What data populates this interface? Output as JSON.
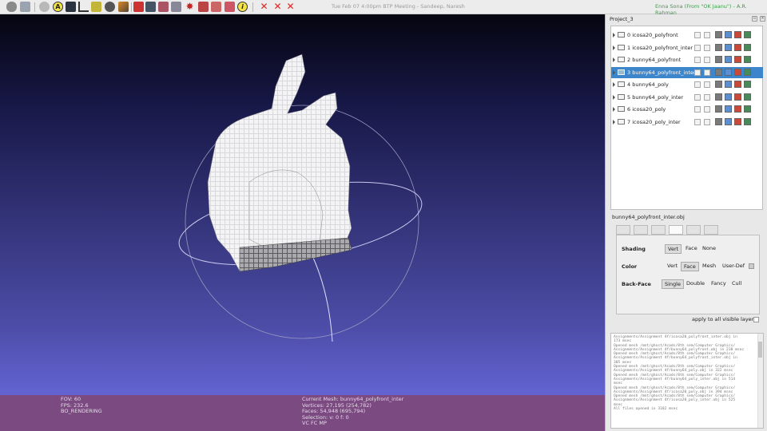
{
  "window": {
    "title": "Tue Feb 07  4:00pm  BTP Meeting - Sandeep, Naresh",
    "notification_name": "Enna Sona (From \"OK Jaanu\")",
    "notification_sep": " - ",
    "notification_artist": "A.R. Rahman"
  },
  "toolbar": {
    "icons": [
      "database-icon",
      "layers-icon",
      "globe-icon",
      "annotation-a-icon",
      "grid-icon",
      "axes-icon",
      "paint-bucket-icon",
      "sphere-icon",
      "brush-icon",
      "pick-icon",
      "texture-icon",
      "measure-icon",
      "align-icon",
      "star-icon",
      "select-faces-icon",
      "select-vertices-icon",
      "palette-icon",
      "info-icon",
      "delete-faces-icon",
      "delete-vertices-icon",
      "delete-selection-icon"
    ]
  },
  "viewport": {
    "fov": "FOV: 60",
    "fps": "FPS:    232.6",
    "render_mode": "BO_RENDERING",
    "current_mesh": "Current Mesh: bunny64_polyfront_inter",
    "vertices": "Vertices: 27,195     (254,782)",
    "faces": "Faces: 54,948     (695,794)",
    "selection": "Selection: v: 0 f: 0",
    "flags": "VC FC MP"
  },
  "panel": {
    "project_title": "Project_3",
    "layers": [
      {
        "index": "0",
        "name": "icosa20_polyfront",
        "selected": false
      },
      {
        "index": "1",
        "name": "icosa20_polyfront_inter",
        "selected": false
      },
      {
        "index": "2",
        "name": "bunny64_polyfront",
        "selected": false
      },
      {
        "index": "3",
        "name": "bunny64_polyfront_inter",
        "selected": true
      },
      {
        "index": "4",
        "name": "bunny64_poly",
        "selected": false
      },
      {
        "index": "5",
        "name": "bunny64_poly_inter",
        "selected": false
      },
      {
        "index": "6",
        "name": "icosa20_poly",
        "selected": false
      },
      {
        "index": "7",
        "name": "icosa20_poly_inter",
        "selected": false
      }
    ],
    "mesh_file": "bunny64_polyfront_inter.obj",
    "render": {
      "shading_label": "Shading",
      "shading_opts": [
        "Vert",
        "Face",
        "None"
      ],
      "color_label": "Color",
      "color_opts": [
        "Vert",
        "Face",
        "Mesh",
        "User-Def"
      ],
      "backface_label": "Back-Face",
      "backface_opts": [
        "Single",
        "Double",
        "Fancy",
        "Cull"
      ]
    },
    "apply_all": "apply to all visible layers",
    "log": "Assignments/Assignment 4f/icosa20_polyfront_inter.obj in\n173 msec\nOpened mesh /mnt/ghost/Acads/8th sem/Computer Graphics/\nAssignments/Assignment 4f/bunny64_polyfront.obj in 238 msec\nOpened mesh /mnt/ghost/Acads/8th sem/Computer Graphics/\nAssignments/Assignment 4f/bunny64_polyfront_inter.obj in\n305 msec\nOpened mesh /mnt/ghost/Acads/8th sem/Computer Graphics/\nAssignments/Assignment 4f/bunny64_poly.obj in 322 msec\nOpened mesh /mnt/ghost/Acads/8th sem/Computer Graphics/\nAssignments/Assignment 4f/bunny64_poly_inter.obj in 514\nmsec\nOpened mesh /mnt/ghost/Acads/8th sem/Computer Graphics/\nAssignments/Assignment 4f/icosa20_poly.obj in 394 msec\nOpened mesh /mnt/ghost/Acads/8th sem/Computer Graphics/\nAssignments/Assignment 4f/icosa20_poly_inter.obj in 525\nmsec\nAll files opened in 3182 msec"
  }
}
